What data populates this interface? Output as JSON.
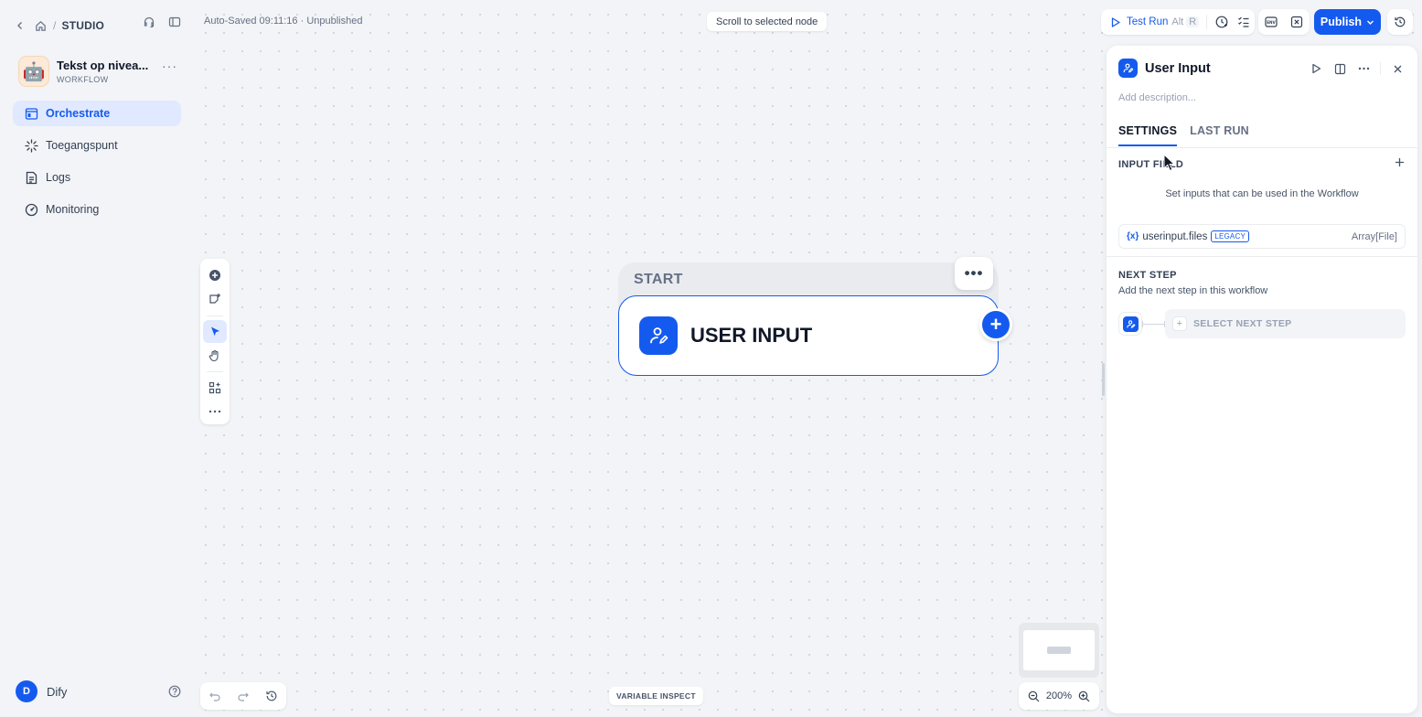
{
  "breadcrumb": {
    "section": "STUDIO"
  },
  "app": {
    "name": "Tekst op nivea...",
    "type": "WORKFLOW",
    "emoji": "🤖"
  },
  "nav": {
    "items": [
      {
        "label": "Orchestrate",
        "icon": "orchestrate-icon",
        "active": true
      },
      {
        "label": "Toegangspunt",
        "icon": "access-point-icon"
      },
      {
        "label": "Logs",
        "icon": "logs-icon"
      },
      {
        "label": "Monitoring",
        "icon": "monitoring-icon"
      }
    ]
  },
  "user": {
    "initial": "D",
    "name": "Dify"
  },
  "canvas": {
    "autosave": "Auto-Saved 09:11:16 · Unpublished",
    "scroll_button": "Scroll to selected node",
    "variable_inspect": "VARIABLE INSPECT",
    "zoom": "200%"
  },
  "node": {
    "group_label": "START",
    "title": "USER INPUT"
  },
  "toolbar": {
    "test_run": "Test Run",
    "shortcut_mod": "Alt",
    "shortcut_key": "R",
    "publish": "Publish"
  },
  "panel": {
    "title": "User Input",
    "description_placeholder": "Add description...",
    "tabs": [
      {
        "label": "SETTINGS",
        "active": true
      },
      {
        "label": "LAST RUN"
      }
    ],
    "input_field": {
      "title": "INPUT FIELD",
      "note": "Set inputs that can be used in the Workflow",
      "variable": {
        "prefix": "{x}",
        "name": "userinput.files",
        "badge": "LEGACY",
        "type": "Array[File]"
      }
    },
    "next_step": {
      "title": "NEXT STEP",
      "description": "Add the next step in this workflow",
      "select_label": "SELECT NEXT STEP"
    }
  },
  "colors": {
    "accent": "#155aef",
    "background": "#f2f4f7"
  }
}
